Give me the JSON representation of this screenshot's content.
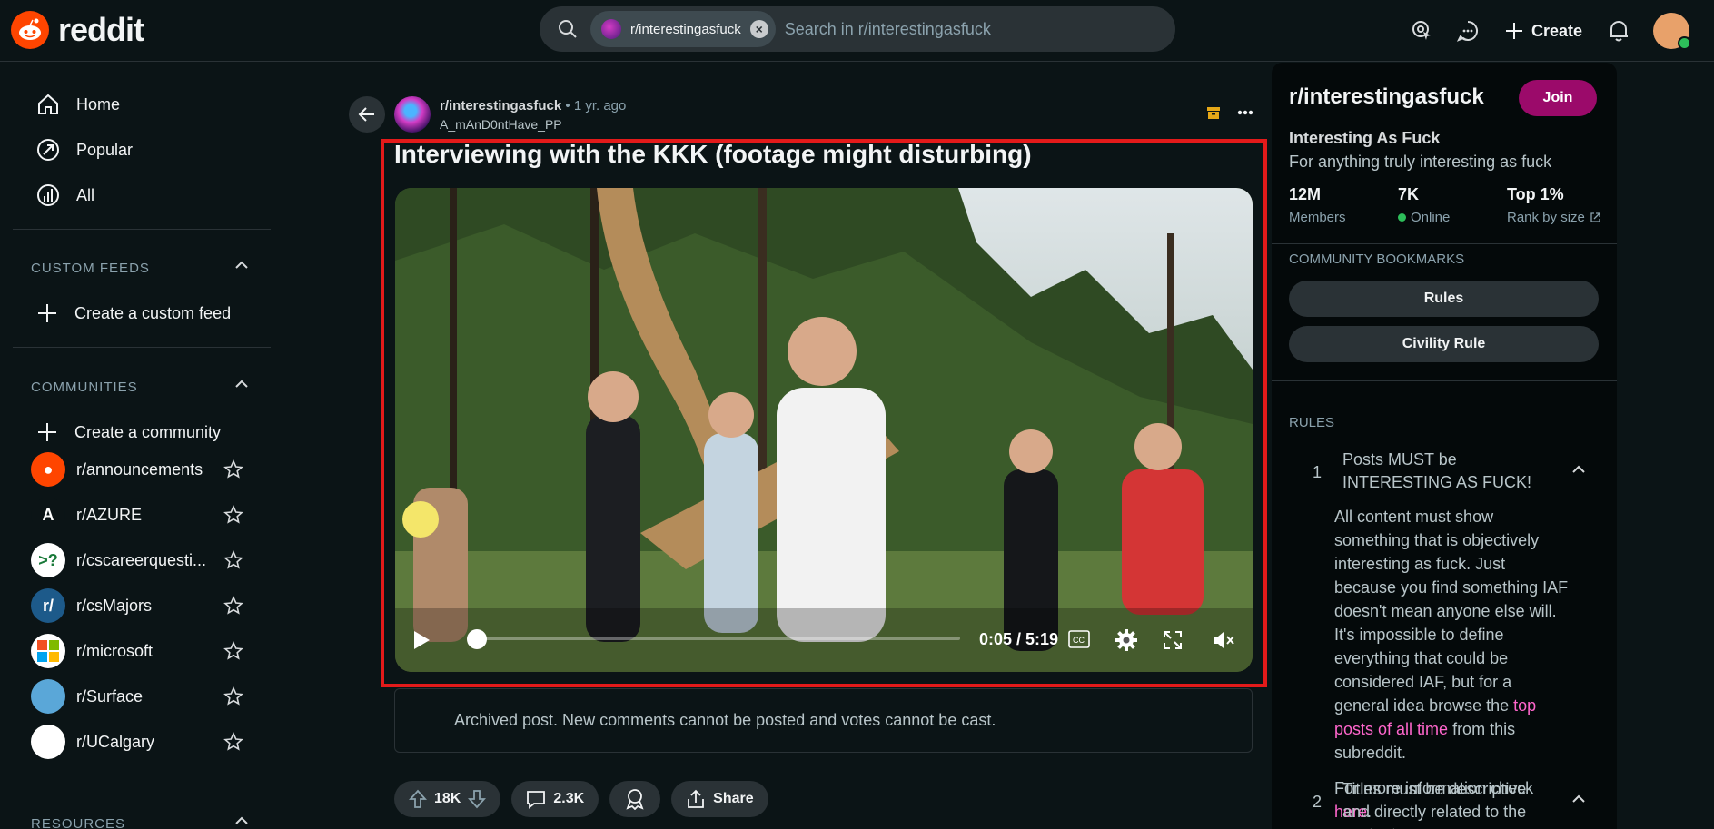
{
  "header": {
    "logo_text": "reddit",
    "search_chip": "r/interestingasfuck",
    "search_placeholder": "Search in r/interestingasfuck",
    "create_label": "Create"
  },
  "sidebar": {
    "nav": [
      {
        "label": "Home",
        "icon": "home-icon"
      },
      {
        "label": "Popular",
        "icon": "popular-icon"
      },
      {
        "label": "All",
        "icon": "all-icon"
      }
    ],
    "custom_feeds_title": "CUSTOM FEEDS",
    "create_feed": "Create a custom feed",
    "communities_title": "COMMUNITIES",
    "create_community": "Create a community",
    "communities": [
      {
        "name": "r/announcements",
        "color": "#ff4500",
        "glyph": "●"
      },
      {
        "name": "r/AZURE",
        "color": "#0b1416",
        "glyph": "A"
      },
      {
        "name": "r/cscareerquesti...",
        "color": "#ffffff",
        "glyph": ">?"
      },
      {
        "name": "r/csMajors",
        "color": "#1d5a8a",
        "glyph": "r/"
      },
      {
        "name": "r/microsoft",
        "color": "#ffffff",
        "glyph": ""
      },
      {
        "name": "r/Surface",
        "color": "#5aa7d8",
        "glyph": ""
      },
      {
        "name": "r/UCalgary",
        "color": "#ffffff",
        "glyph": ""
      }
    ],
    "resources_title": "RESOURCES"
  },
  "post": {
    "subreddit": "r/interestingasfuck",
    "age": "1 yr. ago",
    "author": "A_mAnD0ntHave_PP",
    "title": "Interviewing with the KKK (footage might disturbing)",
    "video_time": "0:05 / 5:19",
    "video_progress": 0.016,
    "archived_notice": "Archived post. New comments cannot be posted and votes cannot be cast.",
    "votes": "18K",
    "comments": "2.3K",
    "share_label": "Share"
  },
  "right_panel": {
    "title": "r/interestingasfuck",
    "join_label": "Join",
    "name": "Interesting As Fuck",
    "description": "For anything truly interesting as fuck",
    "stats": [
      {
        "value": "12M",
        "label": "Members"
      },
      {
        "value": "7K",
        "label": "Online"
      },
      {
        "value": "Top 1%",
        "label": "Rank by size"
      }
    ],
    "bookmarks_title": "COMMUNITY BOOKMARKS",
    "bookmarks": [
      "Rules",
      "Civility Rule"
    ],
    "rules_title": "RULES",
    "rules": [
      {
        "num": "1",
        "title": "Posts MUST be INTERESTING AS FUCK!"
      },
      {
        "num": "2",
        "title": "Titles must be descriptive and directly related to the content"
      }
    ],
    "rule1_body_a": "All content must show something that is objectively interesting as fuck. Just because you find something IAF doesn't mean anyone else will. It's impossible to define everything that could be considered IAF, but for a general idea browse the ",
    "rule1_link": "top posts of all time",
    "rule1_body_b": " from this subreddit.",
    "rule1_more_a": "For more information check ",
    "rule1_more_link": "here",
    "rule1_more_b": "."
  },
  "colors": {
    "background": "#0b1416",
    "accent": "#ff4500",
    "join": "#9b0a6a",
    "highlight_box": "#e31a1a",
    "link": "#ff66cc"
  }
}
